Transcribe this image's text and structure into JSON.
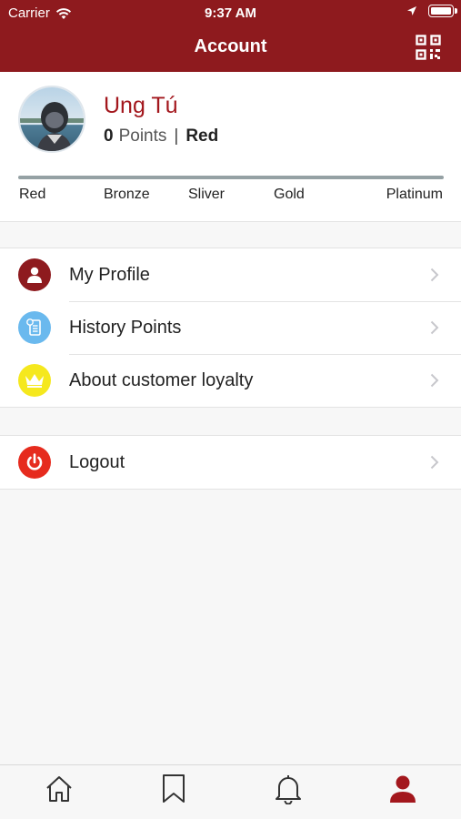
{
  "status_bar": {
    "carrier": "Carrier",
    "time": "9:37 AM"
  },
  "header": {
    "title": "Account",
    "qr_icon": "qr-code-icon"
  },
  "profile": {
    "name": "Ung Tú",
    "points_value": "0",
    "points_label": "Points",
    "separator": "|",
    "tier": "Red",
    "tier_progress": 0.0,
    "tiers": [
      "Red",
      "Bronze",
      "Sliver",
      "Gold",
      "Platinum"
    ]
  },
  "menu": {
    "group1": [
      {
        "label": "My Profile",
        "icon": "user-icon",
        "color": "#8e1a1e"
      },
      {
        "label": "History Points",
        "icon": "history-icon",
        "color": "#6ab9ee"
      },
      {
        "label": "About customer loyalty",
        "icon": "crown-icon",
        "color": "#f5e81e"
      }
    ],
    "group2": [
      {
        "label": "Logout",
        "icon": "power-icon",
        "color": "#e62b1e"
      }
    ]
  },
  "tabbar": {
    "tabs": [
      {
        "icon": "home-icon",
        "active": false
      },
      {
        "icon": "bookmark-icon",
        "active": false
      },
      {
        "icon": "bell-icon",
        "active": false
      },
      {
        "icon": "account-icon",
        "active": true
      }
    ]
  },
  "colors": {
    "brand": "#8e1a1e",
    "accent": "#a3171d",
    "background": "#f7f7f7"
  }
}
